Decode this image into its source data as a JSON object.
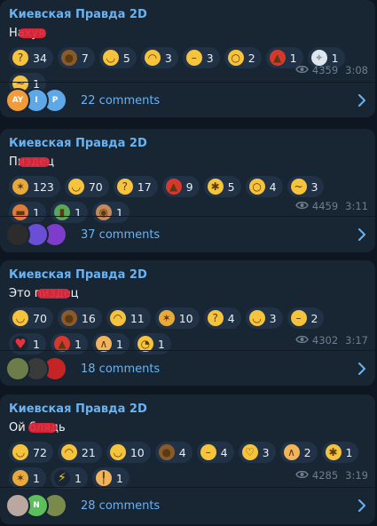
{
  "posts": [
    {
      "channel": "Киевская Правда 2D",
      "text": "Нахуя",
      "reactions": [
        {
          "icon": "thinking-face-icon",
          "glyph": "?",
          "color": "#f6c33c",
          "count": "34"
        },
        {
          "icon": "pile-of-poo-icon",
          "glyph": "●",
          "color": "#8a5a2b",
          "count": "7"
        },
        {
          "icon": "rofl-face-icon",
          "glyph": "◡",
          "color": "#f6c33c",
          "count": "5"
        },
        {
          "icon": "crying-face-icon",
          "glyph": "◠",
          "color": "#f6c33c",
          "count": "3"
        },
        {
          "icon": "neutral-face-icon",
          "glyph": "–",
          "color": "#f6c33c",
          "count": "3"
        },
        {
          "icon": "screaming-face-icon",
          "glyph": "○",
          "color": "#f6c33c",
          "count": "2"
        },
        {
          "icon": "angry-face-icon",
          "glyph": "▲",
          "color": "#d6382e",
          "count": "1"
        },
        {
          "icon": "dove-icon",
          "glyph": "✦",
          "color": "#dfe7ee",
          "count": "1"
        },
        {
          "icon": "zany-face-icon",
          "glyph": "~",
          "color": "#f6c33c",
          "count": "1"
        }
      ],
      "views": "4359",
      "time": "3:08",
      "comments": "22 comments",
      "avatars": [
        {
          "initials": "AY",
          "color": "#f29b38"
        },
        {
          "initials": "I",
          "color": "#5fa8e8"
        },
        {
          "initials": "P",
          "color": "#5fa8e8"
        }
      ]
    },
    {
      "channel": "Киевская Правда 2D",
      "text": "Пиздец",
      "reactions": [
        {
          "icon": "party-popper-icon",
          "glyph": "✶",
          "color": "#e9a93b",
          "count": "123"
        },
        {
          "icon": "grinning-face-icon",
          "glyph": "◡",
          "color": "#f6c33c",
          "count": "70"
        },
        {
          "icon": "thinking-face-icon",
          "glyph": "?",
          "color": "#f6c33c",
          "count": "17"
        },
        {
          "icon": "angry-face-icon",
          "glyph": "▲",
          "color": "#d6382e",
          "count": "9"
        },
        {
          "icon": "exploding-head-icon",
          "glyph": "✱",
          "color": "#f6c33c",
          "count": "5"
        },
        {
          "icon": "screaming-face-icon",
          "glyph": "○",
          "color": "#f6c33c",
          "count": "4"
        },
        {
          "icon": "zany-face-icon",
          "glyph": "~",
          "color": "#f6c33c",
          "count": "3"
        },
        {
          "icon": "hot-dog-icon",
          "glyph": "▬",
          "color": "#e07b39",
          "count": "1"
        },
        {
          "icon": "champagne-icon",
          "glyph": "▮",
          "color": "#5aa65a",
          "count": "1"
        },
        {
          "icon": "see-no-evil-monkey-icon",
          "glyph": "◉",
          "color": "#c48a5a",
          "count": "1"
        }
      ],
      "views": "4459",
      "time": "3:11",
      "comments": "37 comments",
      "avatars": [
        {
          "initials": "",
          "color": "#2c2c2c"
        },
        {
          "initials": "",
          "color": "#6a4fd6"
        },
        {
          "initials": "",
          "color": "#7d3cc9"
        }
      ]
    },
    {
      "channel": "Киевская Правда 2D",
      "text": "Это пиздец",
      "reactions": [
        {
          "icon": "grinning-face-icon",
          "glyph": "◡",
          "color": "#f6c33c",
          "count": "70"
        },
        {
          "icon": "pile-of-poo-icon",
          "glyph": "●",
          "color": "#8a5a2b",
          "count": "16"
        },
        {
          "icon": "crying-face-icon",
          "glyph": "◠",
          "color": "#f6c33c",
          "count": "11"
        },
        {
          "icon": "party-popper-icon",
          "glyph": "✶",
          "color": "#e9a93b",
          "count": "10"
        },
        {
          "icon": "thinking-face-icon",
          "glyph": "?",
          "color": "#f6c33c",
          "count": "4"
        },
        {
          "icon": "rofl-face-icon",
          "glyph": "◡",
          "color": "#f6c33c",
          "count": "3"
        },
        {
          "icon": "neutral-face-icon",
          "glyph": "–",
          "color": "#f6c33c",
          "count": "2"
        },
        {
          "icon": "red-heart-icon",
          "glyph": "♥",
          "color": "#182533",
          "count": "1"
        },
        {
          "icon": "angry-face-icon",
          "glyph": "▲",
          "color": "#d6382e",
          "count": "1"
        },
        {
          "icon": "folded-hands-icon",
          "glyph": "∧",
          "color": "#f2b35a",
          "count": "1"
        },
        {
          "icon": "pleading-face-icon",
          "glyph": "◔",
          "color": "#f6c33c",
          "count": "1"
        }
      ],
      "views": "4302",
      "time": "3:17",
      "comments": "18 comments",
      "avatars": [
        {
          "initials": "",
          "color": "#6d7d4a"
        },
        {
          "initials": "",
          "color": "#3a3a3a"
        },
        {
          "initials": "",
          "color": "#c52424"
        }
      ]
    },
    {
      "channel": "Киевская Правда 2D",
      "text": "Ой блядь",
      "reactions": [
        {
          "icon": "grinning-face-icon",
          "glyph": "◡",
          "color": "#f6c33c",
          "count": "72"
        },
        {
          "icon": "crying-face-icon",
          "glyph": "◠",
          "color": "#f6c33c",
          "count": "21"
        },
        {
          "icon": "rofl-face-icon",
          "glyph": "◡",
          "color": "#f6c33c",
          "count": "10"
        },
        {
          "icon": "pile-of-poo-icon",
          "glyph": "●",
          "color": "#8a5a2b",
          "count": "4"
        },
        {
          "icon": "neutral-face-icon",
          "glyph": "–",
          "color": "#f6c33c",
          "count": "4"
        },
        {
          "icon": "hugging-face-icon",
          "glyph": "♡",
          "color": "#f6c33c",
          "count": "3"
        },
        {
          "icon": "folded-hands-icon",
          "glyph": "∧",
          "color": "#f2b35a",
          "count": "2"
        },
        {
          "icon": "exploding-head-icon",
          "glyph": "✱",
          "color": "#f6c33c",
          "count": "1"
        },
        {
          "icon": "party-popper-icon",
          "glyph": "✶",
          "color": "#e9a93b",
          "count": "1"
        },
        {
          "icon": "high-voltage-icon",
          "glyph": "⚡",
          "color": "#182533",
          "count": "1"
        },
        {
          "icon": "middle-finger-icon",
          "glyph": "╿",
          "color": "#f2b35a",
          "count": "1"
        }
      ],
      "views": "4285",
      "time": "3:19",
      "comments": "28 comments",
      "avatars": [
        {
          "initials": "",
          "color": "#b9a7a0"
        },
        {
          "initials": "N",
          "color": "#5cbf5c"
        },
        {
          "initials": "",
          "color": "#7a8a4a"
        }
      ]
    }
  ]
}
